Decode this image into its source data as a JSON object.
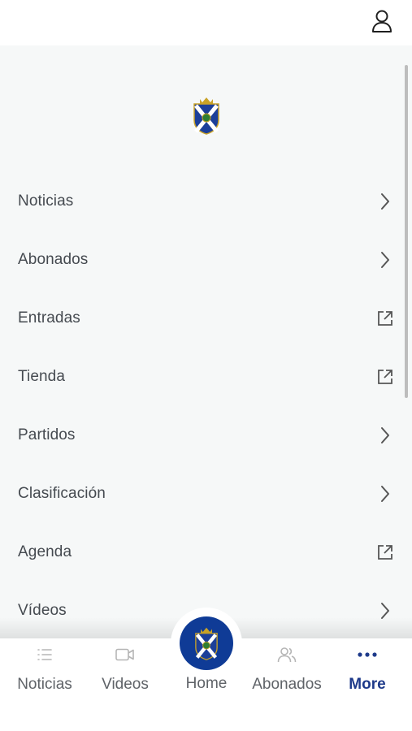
{
  "header": {
    "profile_icon": "user-icon"
  },
  "menu": {
    "logo_icon": "club-crest-icon",
    "items": [
      {
        "label": "Noticias",
        "trail": "chevron-right-icon"
      },
      {
        "label": "Abonados",
        "trail": "chevron-right-icon"
      },
      {
        "label": "Entradas",
        "trail": "external-link-icon"
      },
      {
        "label": "Tienda",
        "trail": "external-link-icon"
      },
      {
        "label": "Partidos",
        "trail": "chevron-right-icon"
      },
      {
        "label": "Clasificación",
        "trail": "chevron-right-icon"
      },
      {
        "label": "Agenda",
        "trail": "external-link-icon"
      },
      {
        "label": "Vídeos",
        "trail": "chevron-right-icon"
      }
    ]
  },
  "bottom_nav": {
    "items": [
      {
        "label": "Noticias",
        "icon": "list-icon"
      },
      {
        "label": "Videos",
        "icon": "video-camera-icon"
      },
      {
        "label": "Home",
        "icon": "club-crest-icon"
      },
      {
        "label": "Abonados",
        "icon": "members-icon"
      },
      {
        "label": "More",
        "icon": "more-dots-icon",
        "active": true
      }
    ]
  },
  "colors": {
    "accent": "#1e3a8a",
    "home_button": "#0f3b96",
    "panel_bg": "#f6f8f8"
  }
}
